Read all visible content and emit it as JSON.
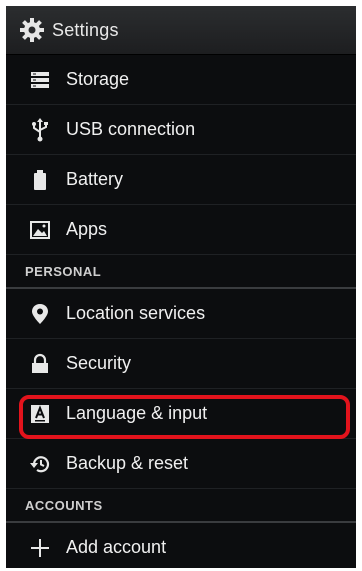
{
  "action_bar": {
    "title": "Settings",
    "icon": "gear-icon"
  },
  "settings_list": [
    {
      "type": "item",
      "label": "Storage",
      "icon": "storage-icon"
    },
    {
      "type": "item",
      "label": "USB connection",
      "icon": "usb-icon"
    },
    {
      "type": "item",
      "label": "Battery",
      "icon": "battery-icon"
    },
    {
      "type": "item",
      "label": "Apps",
      "icon": "apps-icon"
    },
    {
      "type": "header",
      "label": "PERSONAL"
    },
    {
      "type": "item",
      "label": "Location services",
      "icon": "location-icon"
    },
    {
      "type": "item",
      "label": "Security",
      "icon": "lock-icon"
    },
    {
      "type": "item",
      "label": "Language & input",
      "icon": "language-icon",
      "highlighted": true
    },
    {
      "type": "item",
      "label": "Backup & reset",
      "icon": "backup-icon"
    },
    {
      "type": "header",
      "label": "ACCOUNTS"
    },
    {
      "type": "item",
      "label": "Add account",
      "icon": "add-icon"
    }
  ],
  "colors": {
    "background": "#0c0d0f",
    "text": "#f0f0f0",
    "highlight_border": "#e3131c"
  }
}
